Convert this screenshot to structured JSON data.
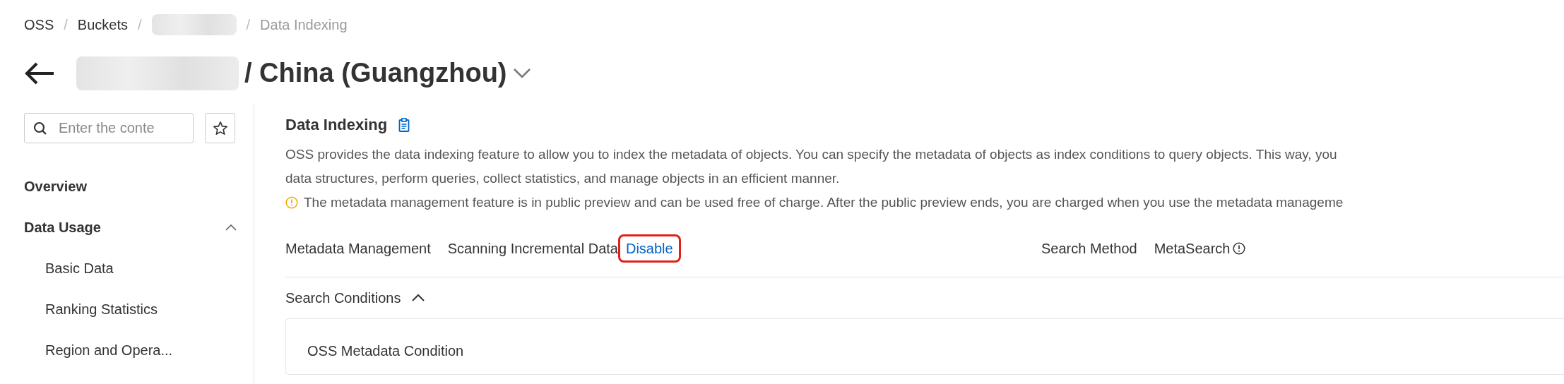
{
  "breadcrumb": [
    {
      "label": "OSS",
      "redacted": false,
      "current": false
    },
    {
      "separator": "/",
      "label": "Buckets",
      "redacted": false,
      "current": false
    },
    {
      "separator": "/",
      "redacted": true
    },
    {
      "separator": "/",
      "label": "Data Indexing",
      "redacted": false,
      "current": true
    }
  ],
  "header": {
    "name_redacted": true,
    "title": "/ China (Guangzhou)"
  },
  "sidebar": {
    "search": {
      "placeholder": "Enter the conte"
    },
    "items": [
      {
        "label": "Overview"
      },
      {
        "label": "Data Usage",
        "expanded": true,
        "children": [
          {
            "label": "Basic Data"
          },
          {
            "label": "Ranking Statistics"
          },
          {
            "label": "Region and Opera..."
          }
        ]
      }
    ]
  },
  "section": {
    "title": "Data Indexing",
    "description_lines": [
      "OSS provides the data indexing feature to allow you to index the metadata of objects. You can specify the metadata of objects as index conditions to query objects. This way, you",
      "data structures, perform queries, collect statistics, and manage objects in an efficient manner."
    ],
    "notice": "The metadata management feature is in public preview and can be used free of charge. After the public preview ends, you are charged when you use the metadata manageme",
    "metadata": {
      "label": "Metadata Management",
      "status": "Scanning Incremental Data",
      "action": {
        "label": "Disable",
        "highlighted": true
      }
    },
    "search_method": {
      "label": "Search Method",
      "value": "MetaSearch"
    },
    "conditions": {
      "label": "Search Conditions",
      "expanded": true,
      "card_title": "OSS Metadata Condition"
    }
  }
}
